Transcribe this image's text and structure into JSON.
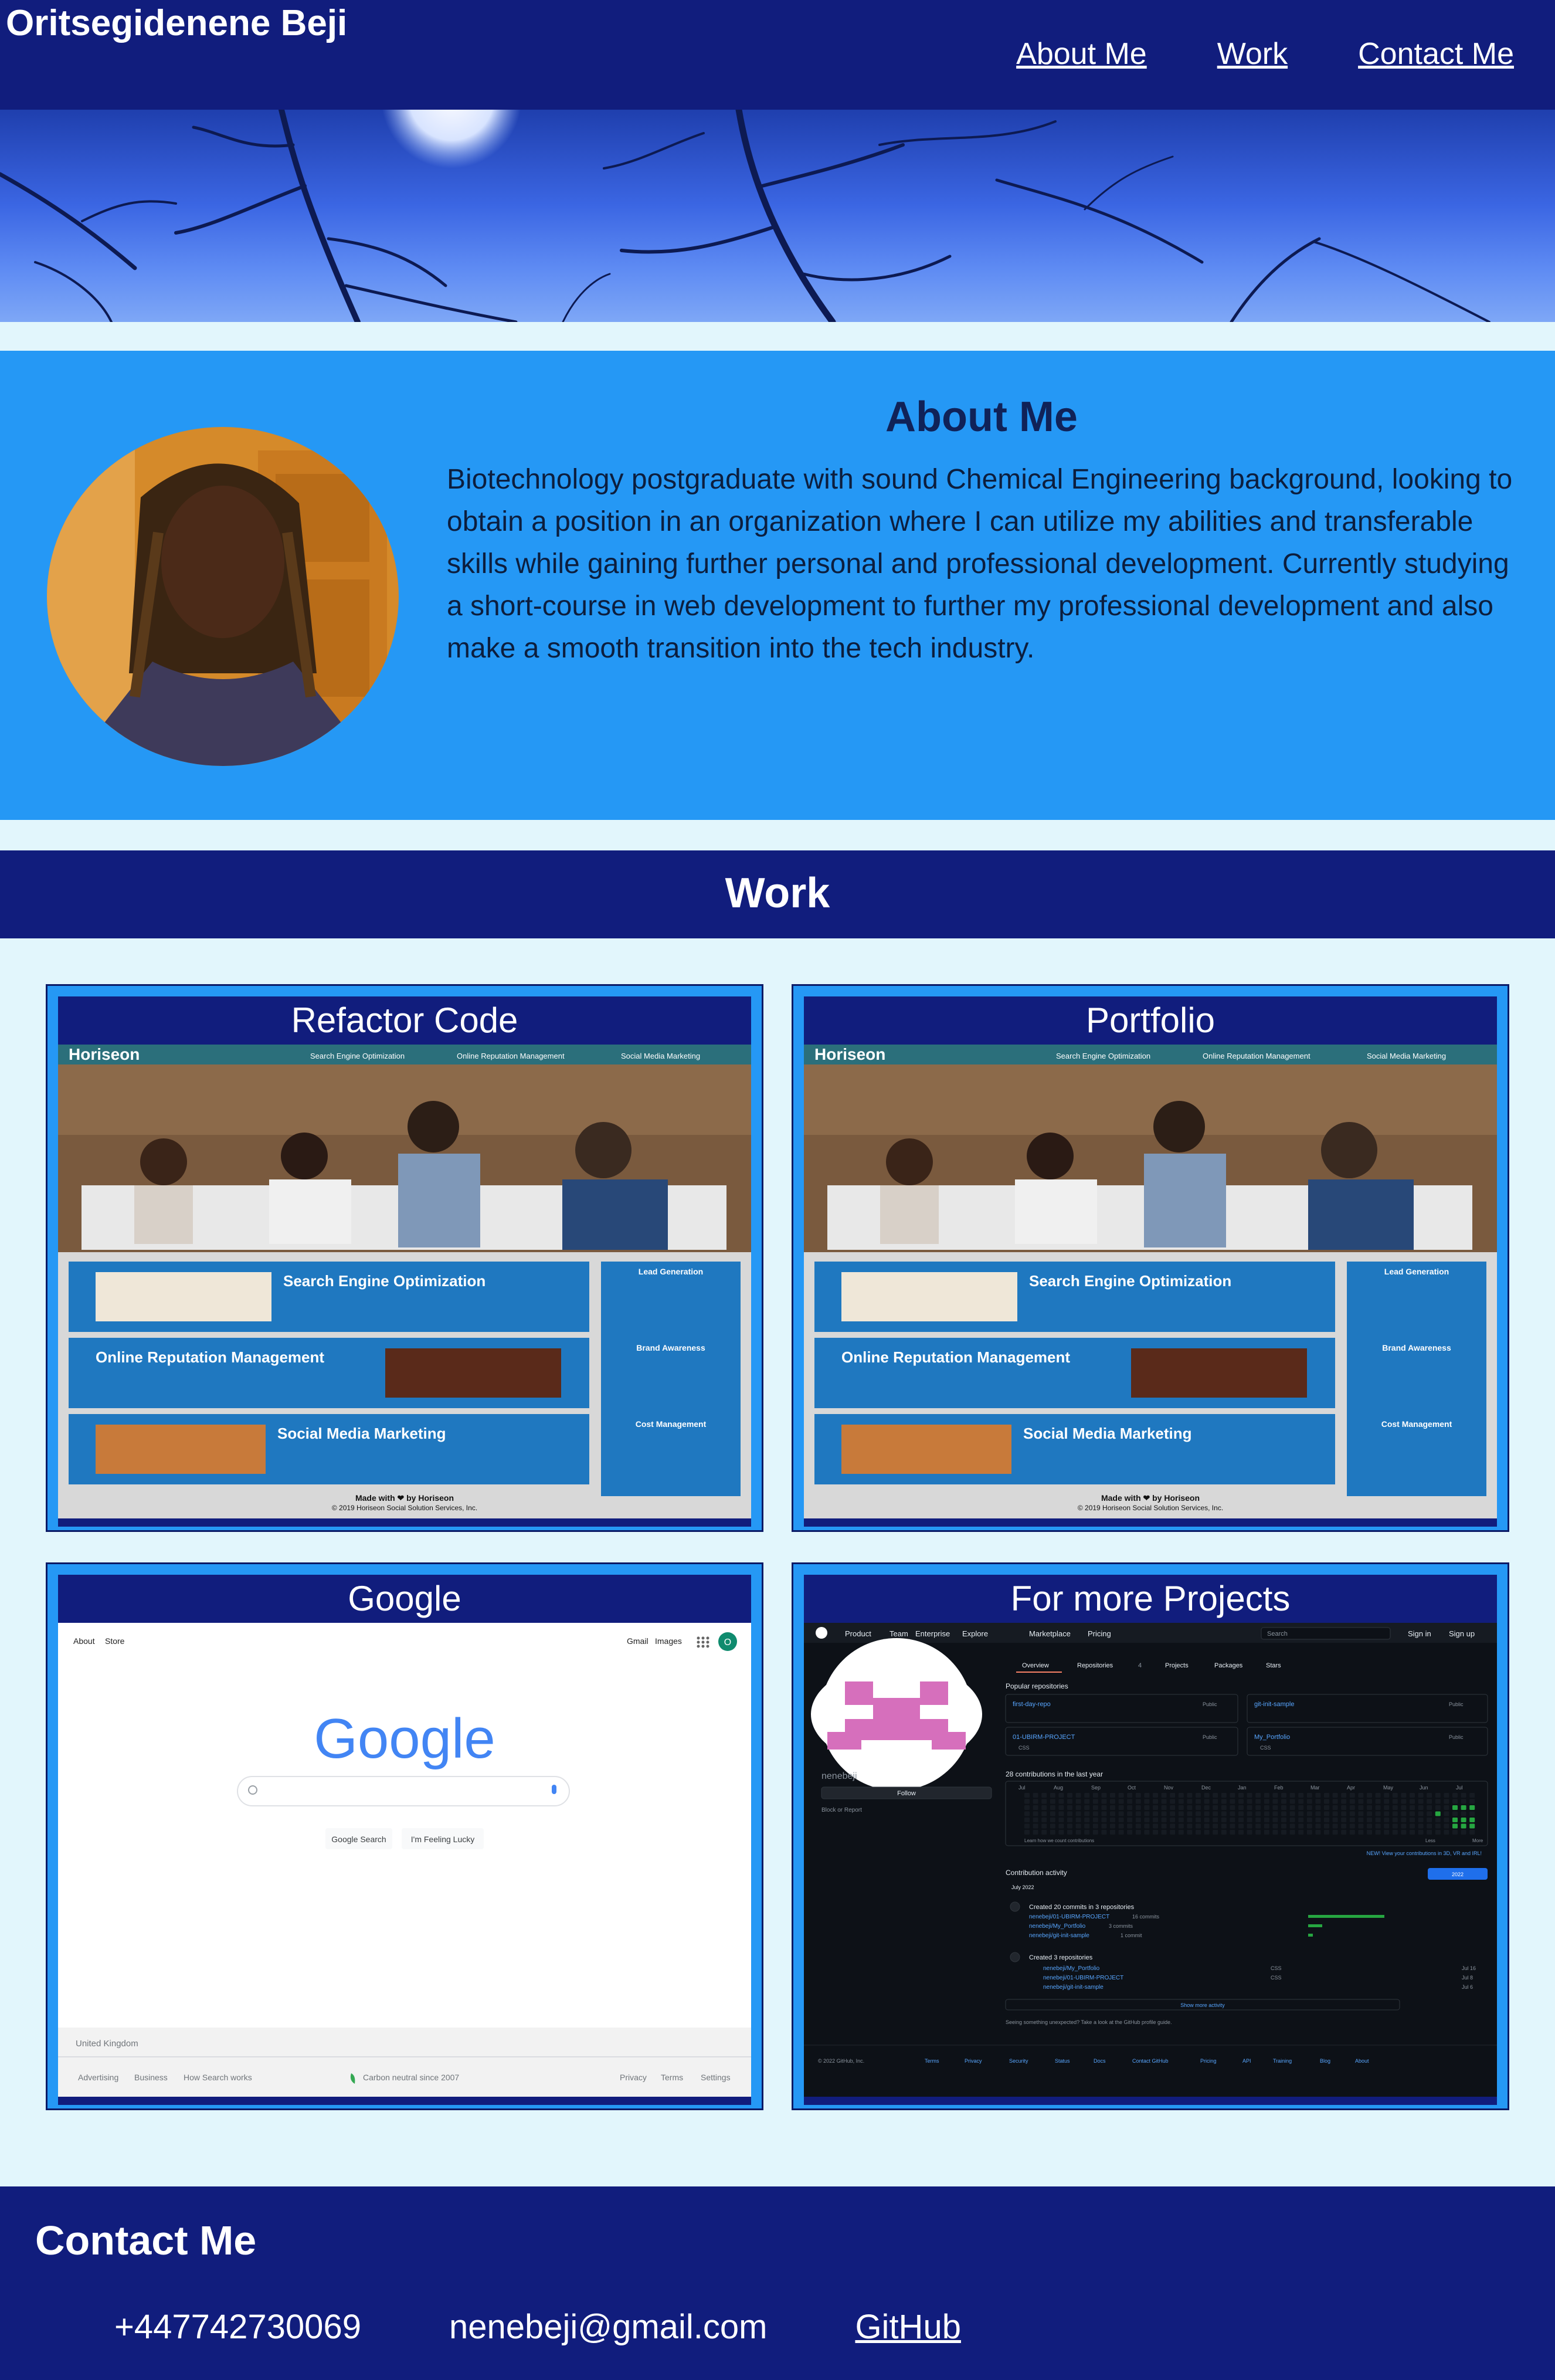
{
  "header": {
    "site_title": "Oritsegidenene Beji",
    "nav": [
      {
        "label": "About Me"
      },
      {
        "label": "Work"
      },
      {
        "label": "Contact Me"
      }
    ]
  },
  "about": {
    "title": "About Me",
    "text": "Biotechnology postgraduate with sound Chemical Engineering background, looking to obtain a position in an organization where I can utilize my abilities and transferable skills while gaining further personal and professional development. Currently studying a short-course in web development to further my professional development and also make a smooth transition into the tech industry."
  },
  "work": {
    "title": "Work",
    "projects": [
      {
        "title": "Refactor Code",
        "shot": {
          "brand": "Horiseon",
          "nav": [
            "Search Engine Optimization",
            "Online Reputation Management",
            "Social Media Marketing"
          ],
          "sections": [
            "Search Engine Optimization",
            "Online Reputation Management",
            "Social Media Marketing"
          ],
          "side": [
            "Lead Generation",
            "Brand Awareness",
            "Cost Management"
          ],
          "footer": "Made with ❤ by Horiseon",
          "copyright": "© 2019 Horiseon Social Solution Services, Inc."
        }
      },
      {
        "title": "Portfolio",
        "shot": {
          "brand": "Horiseon",
          "nav": [
            "Search Engine Optimization",
            "Online Reputation Management",
            "Social Media Marketing"
          ],
          "sections": [
            "Search Engine Optimization",
            "Online Reputation Management",
            "Social Media Marketing"
          ],
          "side": [
            "Lead Generation",
            "Brand Awareness",
            "Cost Management"
          ],
          "footer": "Made with ❤ by Horiseon",
          "copyright": "© 2019 Horiseon Social Solution Services, Inc."
        }
      },
      {
        "title": "Google",
        "shot": {
          "top_left": [
            "About",
            "Store"
          ],
          "top_right": [
            "Gmail",
            "Images"
          ],
          "account_initial": "O",
          "logo": "Google",
          "buttons": [
            "Google Search",
            "I'm Feeling Lucky"
          ],
          "country": "United Kingdom",
          "footer_left": [
            "Advertising",
            "Business",
            "How Search works"
          ],
          "footer_mid": "Carbon neutral since 2007",
          "footer_right": [
            "Privacy",
            "Terms",
            "Settings"
          ]
        }
      },
      {
        "title": "For more Projects",
        "shot": {
          "nav": [
            "Product",
            "Team",
            "Enterprise",
            "Explore",
            "Marketplace",
            "Pricing"
          ],
          "search": "Search",
          "auth": [
            "Sign in",
            "Sign up"
          ],
          "tabs": [
            "Overview",
            "Repositories",
            "Projects",
            "Packages",
            "Stars"
          ],
          "repo_count": "4",
          "username": "nenebeji",
          "follow": "Follow",
          "block": "Block or Report",
          "popular": "Popular repositories",
          "repos": [
            {
              "name": "first-day-repo",
              "badge": "Public"
            },
            {
              "name": "git-init-sample",
              "badge": "Public"
            },
            {
              "name": "01-UBIRM-PROJECT",
              "badge": "Public",
              "lang": "CSS"
            },
            {
              "name": "My_Portfolio",
              "badge": "Public",
              "lang": "CSS"
            }
          ],
          "contrib_title": "28 contributions in the last year",
          "months": [
            "Jul",
            "Aug",
            "Sep",
            "Oct",
            "Nov",
            "Dec",
            "Jan",
            "Feb",
            "Mar",
            "Apr",
            "May",
            "Jun",
            "Jul"
          ],
          "learn": "Learn how we count contributions",
          "legend_less": "Less",
          "legend_more": "More",
          "new_note": "NEW! View your contributions in 3D, VR and IRL!",
          "activity": "Contribution activity",
          "year": "2022",
          "month": "July 2022",
          "commits_title": "Created 20 commits in 3 repositories",
          "commit_repos": [
            {
              "name": "nenebeji/01-UBIRM-PROJECT",
              "count": "16 commits"
            },
            {
              "name": "nenebeji/My_Portfolio",
              "count": "3 commits"
            },
            {
              "name": "nenebeji/git-init-sample",
              "count": "1 commit"
            }
          ],
          "created_title": "Created 3 repositories",
          "created_repos": [
            {
              "name": "nenebeji/My_Portfolio",
              "lang": "CSS",
              "date": "Jul 16"
            },
            {
              "name": "nenebeji/01-UBIRM-PROJECT",
              "lang": "CSS",
              "date": "Jul 8"
            },
            {
              "name": "nenebeji/git-init-sample",
              "date": "Jul 6"
            }
          ],
          "show_more": "Show more activity",
          "note": "Seeing something unexpected? Take a look at the GitHub profile guide.",
          "footer": [
            "© 2022 GitHub, Inc.",
            "Terms",
            "Privacy",
            "Security",
            "Status",
            "Docs",
            "Contact GitHub",
            "Pricing",
            "API",
            "Training",
            "Blog",
            "About"
          ]
        }
      }
    ]
  },
  "contact": {
    "title": "Contact Me",
    "phone": "+447742730069",
    "email": "nenebeji@gmail.com",
    "github": "GitHub"
  },
  "colors": {
    "navy": "#111d7d",
    "blue": "#2598f5",
    "page_bg": "#e2f6fc"
  }
}
